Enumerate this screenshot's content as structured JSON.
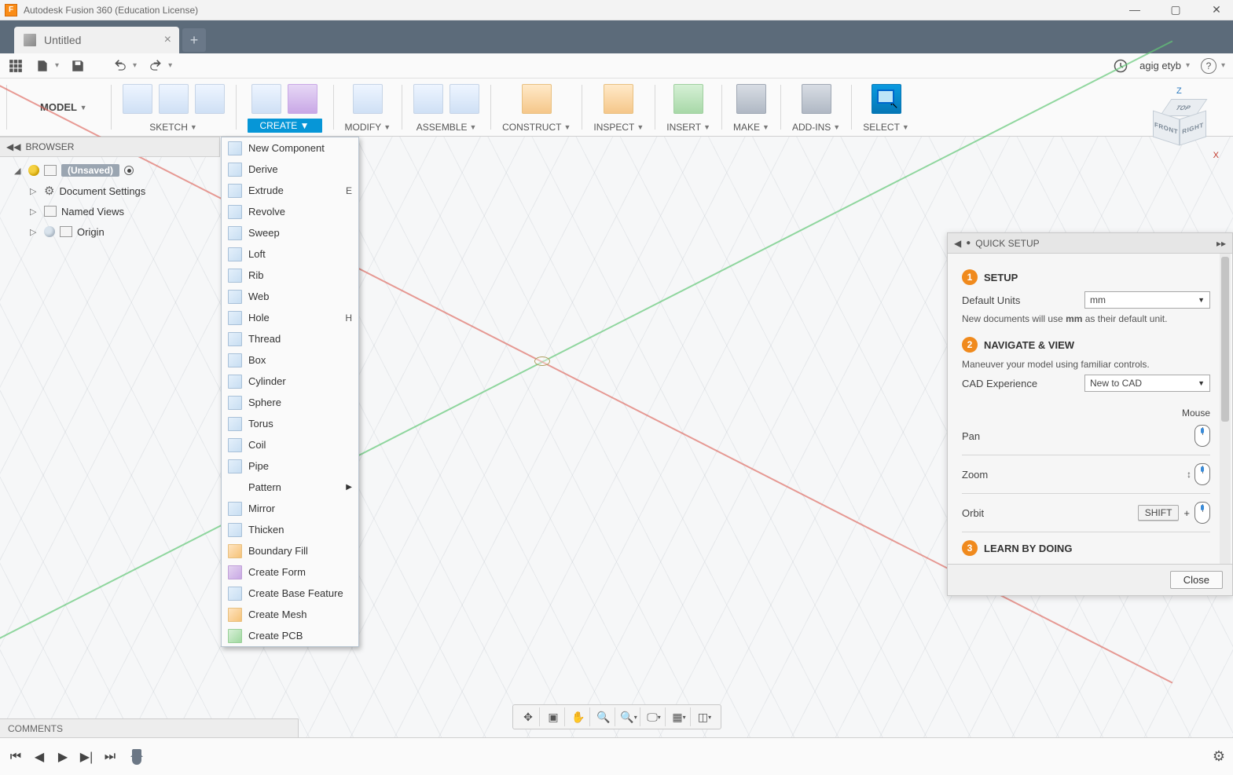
{
  "app": {
    "title": "Autodesk Fusion 360 (Education License)",
    "logo_letter": "F"
  },
  "tabs": {
    "doc_title": "Untitled"
  },
  "qat": {
    "username": "agig etyb"
  },
  "ribbon": {
    "model_label": "MODEL",
    "groups": {
      "sketch": "SKETCH",
      "create": "CREATE",
      "modify": "MODIFY",
      "assemble": "ASSEMBLE",
      "construct": "CONSTRUCT",
      "inspect": "INSPECT",
      "insert": "INSERT",
      "make": "MAKE",
      "addins": "ADD-INS",
      "select": "SELECT"
    }
  },
  "browser": {
    "header": "BROWSER",
    "root_label": "(Unsaved)",
    "items": {
      "doc_settings": "Document Settings",
      "named_views": "Named Views",
      "origin": "Origin"
    }
  },
  "create_menu": {
    "new_component": "New Component",
    "derive": "Derive",
    "extrude": "Extrude",
    "extrude_key": "E",
    "revolve": "Revolve",
    "sweep": "Sweep",
    "loft": "Loft",
    "rib": "Rib",
    "web": "Web",
    "hole": "Hole",
    "hole_key": "H",
    "thread": "Thread",
    "box": "Box",
    "cylinder": "Cylinder",
    "sphere": "Sphere",
    "torus": "Torus",
    "coil": "Coil",
    "pipe": "Pipe",
    "pattern": "Pattern",
    "mirror": "Mirror",
    "thicken": "Thicken",
    "boundary_fill": "Boundary Fill",
    "create_form": "Create Form",
    "create_base": "Create Base Feature",
    "create_mesh": "Create Mesh",
    "create_pcb": "Create PCB"
  },
  "quick_setup": {
    "header": "QUICK SETUP",
    "step1": "SETUP",
    "default_units_label": "Default Units",
    "default_units_value": "mm",
    "units_note_pre": "New documents will use ",
    "units_note_bold": "mm",
    "units_note_post": " as their default unit.",
    "step2": "NAVIGATE & VIEW",
    "maneuver_note": "Maneuver your model using familiar controls.",
    "cad_exp_label": "CAD Experience",
    "cad_exp_value": "New to CAD",
    "mouse_label": "Mouse",
    "pan": "Pan",
    "zoom": "Zoom",
    "orbit": "Orbit",
    "shift_key": "SHIFT",
    "plus": "+",
    "step3": "LEARN BY DOING",
    "close": "Close"
  },
  "viewcube": {
    "top": "TOP",
    "front": "FRONT",
    "right": "RIGHT",
    "z": "Z",
    "x": "X"
  },
  "comments": {
    "label": "COMMENTS"
  }
}
